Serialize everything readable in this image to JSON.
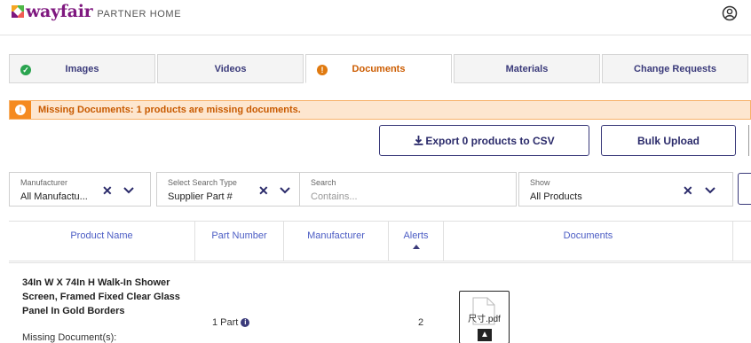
{
  "header": {
    "brand": "wayfair",
    "sub_brand": "PARTNER HOME",
    "brand_color": "#7f187f",
    "user_icon": "user-circle-icon"
  },
  "tabs": [
    {
      "label": "Images",
      "status": "ok",
      "icon": "check-circle-icon"
    },
    {
      "label": "Videos",
      "status": "none"
    },
    {
      "label": "Documents",
      "status": "warning",
      "icon": "alert-circle-icon",
      "active": true
    },
    {
      "label": "Materials",
      "status": "none"
    },
    {
      "label": "Change Requests",
      "status": "none"
    }
  ],
  "alert": {
    "text": "Missing Documents: 1 products are missing documents.",
    "icon": "alert-circle-icon",
    "color": "#f58a1f"
  },
  "actions": {
    "export_label": "Export 0 products to CSV",
    "export_icon": "download-icon",
    "bulk_label": "Bulk Upload"
  },
  "filters": {
    "manufacturer": {
      "label": "Manufacturer",
      "value": "All Manufactu..."
    },
    "search_type": {
      "label": "Select Search Type",
      "value": "Supplier Part #"
    },
    "search": {
      "label": "Search",
      "placeholder": "Contains..."
    },
    "show": {
      "label": "Show",
      "value": "All Products"
    }
  },
  "table": {
    "headers": [
      "Product Name",
      "Part Number",
      "Manufacturer",
      "Alerts",
      "Documents"
    ],
    "sorted_column": "Alerts",
    "rows": [
      {
        "product_name": "34In W X 74In H Walk-In Shower Screen, Framed Fixed Clear Glass Panel In Gold Borders",
        "missing_label": "Missing Document(s):",
        "part": "1 Part",
        "manufacturer": "",
        "alerts": "2",
        "document": {
          "file_name": "尺寸.pdf",
          "icon": "file-icon",
          "action_icon": "upload-icon"
        }
      }
    ]
  },
  "colors": {
    "accent": "#3a3a7a",
    "link": "#4b5cc4",
    "warning": "#f58a1f",
    "success": "#2aa44f"
  }
}
